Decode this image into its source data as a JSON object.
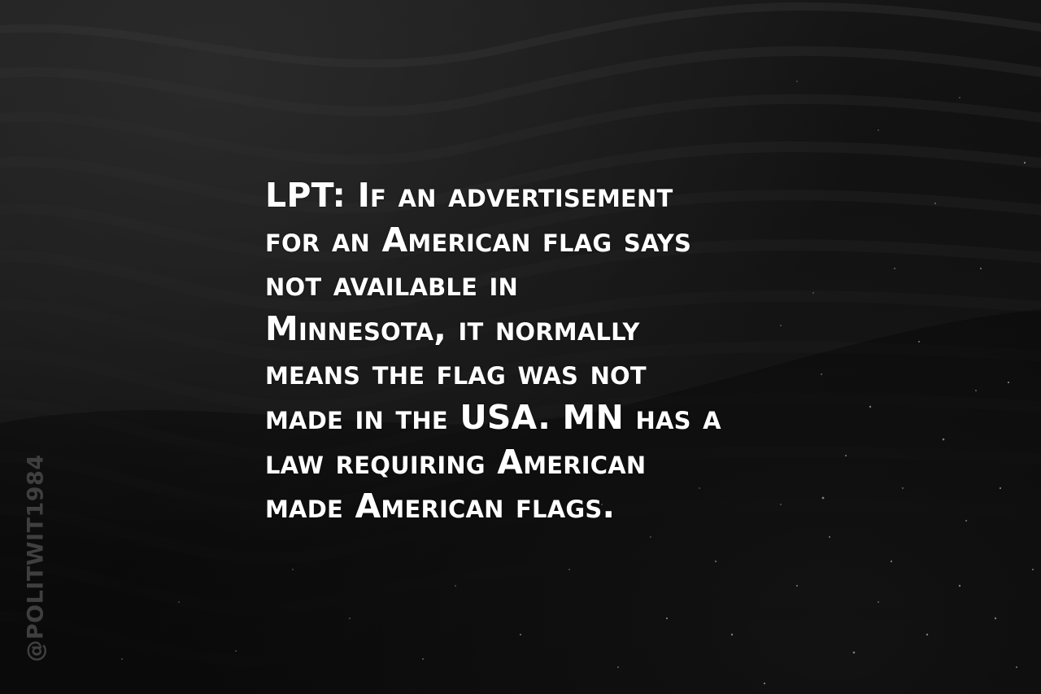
{
  "post": {
    "text": "LPT: If an advertisement\nfor an American flag says\nnot available in\nMinnesota, it normally\nmeans the flag was not\nmade in the USA. MN has a\nlaw requiring American\nmade American flags."
  },
  "watermark": {
    "handle": "@POLITWIT1984"
  },
  "colors": {
    "background": "#111111",
    "text": "#ffffff",
    "watermark": "#3f3f3f"
  }
}
